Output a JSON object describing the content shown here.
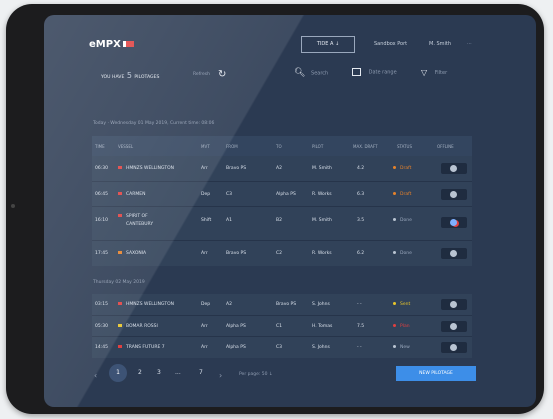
{
  "header": {
    "logo": "eMPX",
    "tide_button": "TIDE A ↓",
    "port": "Sandbox Port",
    "user": "M. Smith",
    "menu": "···"
  },
  "toolbar": {
    "you_have_prefix": "YOU HAVE",
    "pilotage_count": "5",
    "pilotages_word": "PILOTAGES",
    "refresh_label": "Refresh",
    "search_placeholder": "Search",
    "date_range_placeholder": "Date range",
    "filter_label": "Filter"
  },
  "today_label": "Today · Wednesday 01 May 2019, Current time: 08:06",
  "thursday_label": "Thursday 02 May 2019",
  "columns": [
    "TIME",
    "VESSEL",
    "MVT",
    "FROM",
    "TO",
    "PILOT",
    "MAX. DRAFT",
    "STATUS",
    "OFFLINE"
  ],
  "rows_today": [
    {
      "time": "06:30",
      "vessel": "HMNZS WELLINGTON",
      "vessel2": "",
      "mvt": "Arr",
      "from": "Bravo PS",
      "to": "A2",
      "pilot": "M. Smith",
      "draft": "4.2",
      "status": "Draft",
      "flag_color": "#e04040",
      "status_color": "#e6822a"
    },
    {
      "time": "06:45",
      "vessel": "CARMEN",
      "vessel2": "",
      "mvt": "Dep",
      "from": "C3",
      "to": "Alpha PS",
      "pilot": "R. Works",
      "draft": "6.3",
      "status": "Draft",
      "flag_color": "#e04040",
      "status_color": "#e6822a"
    },
    {
      "time": "16:10",
      "vessel": "SPIRIT OF",
      "vessel2": "CANTEBURY",
      "mvt": "Shift",
      "from": "A1",
      "to": "B2",
      "pilot": "M. Smith",
      "draft": "3.5",
      "status": "Done",
      "flag_color": "#e04040",
      "status_color": "#b9c4d2"
    },
    {
      "time": "17:45",
      "vessel": "SAXONIA",
      "vessel2": "",
      "mvt": "Arr",
      "from": "Bravo PS",
      "to": "C2",
      "pilot": "R. Works",
      "draft": "6.2",
      "status": "Done",
      "flag_color": "#e6822a",
      "status_color": "#b9c4d2"
    }
  ],
  "rows_thursday": [
    {
      "time": "03:15",
      "vessel": "HMNZS WELLINGTON",
      "mvt": "Dep",
      "from": "A2",
      "to": "Bravo PS",
      "pilot": "S. Johns",
      "draft": "- -",
      "status": "Sent",
      "flag_color": "#e04040",
      "status_color": "#e8c52a"
    },
    {
      "time": "05:30",
      "vessel": "BOMAR ROSSI",
      "mvt": "Arr",
      "from": "Alpha PS",
      "to": "C1",
      "pilot": "H. Tomas",
      "draft": "7.5",
      "status": "Plan",
      "flag_color": "#e8c52a",
      "status_color": "#e04040"
    },
    {
      "time": "14:45",
      "vessel": "TRANS FUTURE 7",
      "mvt": "Arr",
      "from": "Alpha PS",
      "to": "C3",
      "pilot": "S. Johns",
      "draft": "- -",
      "status": "New",
      "flag_color": "#e04040",
      "status_color": "#b9c4d2"
    }
  ],
  "pagination": {
    "prev": "‹",
    "current": "1",
    "pages": [
      "2",
      "3",
      "...",
      "7"
    ],
    "next": "›",
    "per_page": "Per page: 50 ↓"
  },
  "new_pilotage_button": "NEW PILOTAGE",
  "icons": {
    "refresh": "refresh-icon",
    "search": "search-icon",
    "calendar": "calendar-icon",
    "filter": "filter-icon",
    "offline": "offline-toggle-icon"
  },
  "colors": {
    "screen_bg": "#2b3a52",
    "row_bg": "#314259",
    "accent": "#3d8ee8",
    "draft_status": "#e6822a"
  }
}
